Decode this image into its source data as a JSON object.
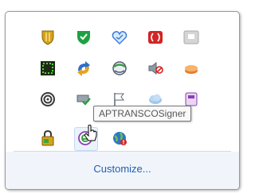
{
  "tray": {
    "icons": [
      {
        "name": "shield-yellow-icon"
      },
      {
        "name": "security-shield-check-icon"
      },
      {
        "name": "heart-shield-icon"
      },
      {
        "name": "red-app-icon"
      },
      {
        "name": "gray-app-icon"
      },
      {
        "name": "green-display-icon"
      },
      {
        "name": "sync-arrows-icon"
      },
      {
        "name": "network-globe-icon"
      },
      {
        "name": "speaker-muted-icon"
      },
      {
        "name": "orange-drive-icon"
      },
      {
        "name": "spiral-icon"
      },
      {
        "name": "usb-check-icon"
      },
      {
        "name": "flag-icon"
      },
      {
        "name": "cloud-icon"
      },
      {
        "name": "purple-app-icon"
      },
      {
        "name": "battery-lock-icon"
      },
      {
        "name": "aptransco-signer-icon"
      },
      {
        "name": "globe-alert-icon"
      }
    ],
    "tooltip": "APTRANSCOSigner",
    "customize_label": "Customize..."
  },
  "colors": {
    "link": "#1e5fb3",
    "footer_bg": "#f1f5fb",
    "border": "#9a9a9a"
  }
}
